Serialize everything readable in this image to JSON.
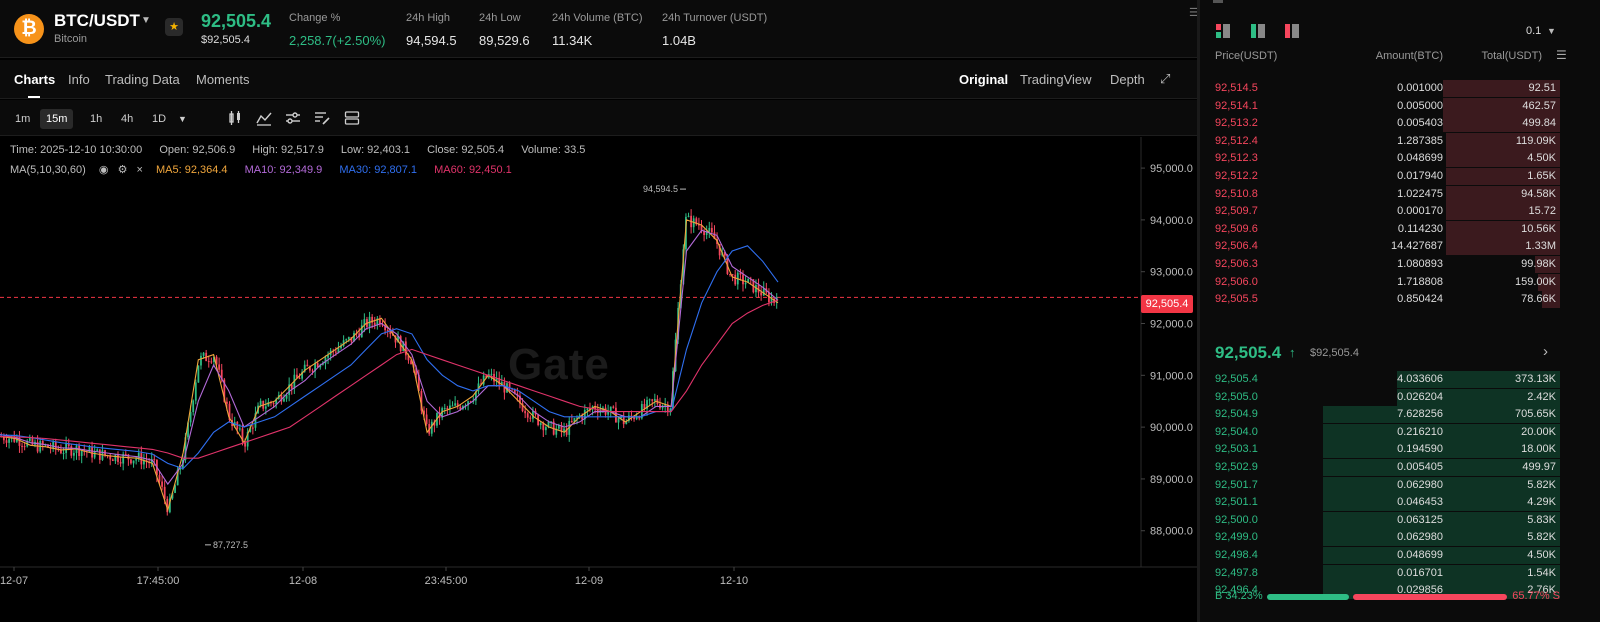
{
  "header": {
    "coin_symbol": "₿",
    "pair": "BTC/USDT",
    "coin_name": "Bitcoin",
    "last_price": "92,505.4",
    "last_price_sub": "$92,505.4",
    "stats": [
      {
        "label": "Change %",
        "value": "2,258.7(+2.50%)",
        "green": true
      },
      {
        "label": "24h High",
        "value": "94,594.5",
        "green": false
      },
      {
        "label": "24h Low",
        "value": "89,529.6",
        "green": false
      },
      {
        "label": "24h Volume (BTC)",
        "value": "11.34K",
        "green": false
      },
      {
        "label": "24h Turnover (USDT)",
        "value": "1.04B",
        "green": false
      }
    ]
  },
  "tabs": [
    "Charts",
    "Info",
    "Trading Data",
    "Moments"
  ],
  "views": [
    "Original",
    "TradingView",
    "Depth"
  ],
  "timeframes": [
    "1m",
    "15m",
    "1h",
    "4h",
    "1D"
  ],
  "tool_icons": [
    "candlestick-icon",
    "indicator-icon",
    "settings-sliders-icon",
    "draw-icon",
    "layout-icon"
  ],
  "chart_info": {
    "time": "Time: 2025-12-10 10:30:00",
    "open": "Open: 92,506.9",
    "high": "High: 92,517.9",
    "low": "Low: 92,403.1",
    "close": "Close: 92,505.4",
    "volume": "Volume: 33.5",
    "ma_label": "MA(5,10,30,60)",
    "ma5": "MA5: 92,364.4",
    "ma10": "MA10: 92,349.9",
    "ma30": "MA30: 92,807.1",
    "ma60": "MA60: 92,450.1"
  },
  "chart_data": {
    "type": "line",
    "title": "",
    "x_ticks": [
      "12-07",
      "17:45:00",
      "12-08",
      "23:45:00",
      "12-09",
      "12-10"
    ],
    "y_ticks": [
      "95,000.0",
      "94,000.0",
      "93,000.0",
      "92,000.0",
      "91,000.0",
      "90,000.0",
      "89,000.0",
      "88,000.0"
    ],
    "ylim": [
      87300,
      95600
    ],
    "current_price": 92505.4,
    "current_price_label": "92,505.4",
    "high_annotation": "94,594.5",
    "low_annotation": "87,727.5",
    "high_value": 94594.5,
    "low_value": 87727.5,
    "watermark": "Gate",
    "colors": {
      "up": "#2ebd85",
      "down": "#f6465d",
      "ma5": "#f0a63c",
      "ma10": "#b36ad8",
      "ma30": "#2f6ff0",
      "ma60": "#e0336a"
    },
    "series": [
      {
        "name": "MA5",
        "values": [
          89820,
          89780,
          89650,
          89620,
          89560,
          89580,
          89500,
          89450,
          89420,
          89400,
          89300,
          88400,
          89500,
          91300,
          91400,
          90200,
          89700,
          90400,
          90500,
          90800,
          91100,
          91300,
          91500,
          91700,
          92000,
          92100,
          91700,
          91300,
          89900,
          90300,
          90400,
          90600,
          91000,
          90800,
          90500,
          90200,
          90000,
          89900,
          90200,
          90400,
          90300,
          90100,
          90300,
          90500,
          90400,
          94000,
          93900,
          93600,
          92900,
          92800,
          92600,
          92400
        ]
      },
      {
        "name": "MA10",
        "values": [
          89860,
          89800,
          89700,
          89660,
          89600,
          89590,
          89540,
          89500,
          89460,
          89430,
          89360,
          88900,
          89300,
          90500,
          91200,
          90700,
          90000,
          90200,
          90400,
          90700,
          90900,
          91200,
          91400,
          91600,
          91900,
          92000,
          91800,
          91400,
          90500,
          90200,
          90300,
          90500,
          90800,
          90800,
          90600,
          90300,
          90100,
          90000,
          90100,
          90300,
          90300,
          90200,
          90200,
          90400,
          90400,
          93400,
          93800,
          93700,
          93100,
          92900,
          92700,
          92450
        ]
      },
      {
        "name": "MA30",
        "values": [
          89850,
          89840,
          89800,
          89750,
          89700,
          89660,
          89620,
          89590,
          89560,
          89530,
          89480,
          89300,
          89200,
          89500,
          89900,
          90100,
          90000,
          90100,
          90200,
          90400,
          90600,
          90800,
          91000,
          91200,
          91500,
          91800,
          91900,
          91800,
          91300,
          91000,
          90800,
          90700,
          90800,
          90800,
          90700,
          90500,
          90300,
          90200,
          90200,
          90200,
          90200,
          90200,
          90200,
          90300,
          90300,
          91500,
          92400,
          93000,
          93400,
          93500,
          93200,
          92800
        ]
      },
      {
        "name": "MA60",
        "values": [
          89820,
          89810,
          89800,
          89780,
          89750,
          89720,
          89690,
          89660,
          89630,
          89600,
          89570,
          89500,
          89400,
          89400,
          89500,
          89600,
          89700,
          89800,
          89900,
          90000,
          90200,
          90400,
          90600,
          90800,
          91000,
          91200,
          91400,
          91500,
          91400,
          91300,
          91200,
          91100,
          91000,
          90900,
          90800,
          90700,
          90600,
          90500,
          90400,
          90350,
          90300,
          90300,
          90300,
          90300,
          90300,
          90700,
          91200,
          91600,
          92000,
          92200,
          92350,
          92450
        ]
      }
    ]
  },
  "orderbook": {
    "tick": "0.1",
    "col_price": "Price(USDT)",
    "col_amount": "Amount(BTC)",
    "col_total": "Total(USDT)",
    "asks": [
      {
        "price": "92,514.5",
        "amount": "0.001000",
        "total": "92.51",
        "depth": 0.38
      },
      {
        "price": "92,514.1",
        "amount": "0.005000",
        "total": "462.57",
        "depth": 0.38
      },
      {
        "price": "92,513.2",
        "amount": "0.005403",
        "total": "499.84",
        "depth": 0.38
      },
      {
        "price": "92,512.4",
        "amount": "1.287385",
        "total": "119.09K",
        "depth": 0.37
      },
      {
        "price": "92,512.3",
        "amount": "0.048699",
        "total": "4.50K",
        "depth": 0.37
      },
      {
        "price": "92,512.2",
        "amount": "0.017940",
        "total": "1.65K",
        "depth": 0.37
      },
      {
        "price": "92,510.8",
        "amount": "1.022475",
        "total": "94.58K",
        "depth": 0.37
      },
      {
        "price": "92,509.7",
        "amount": "0.000170",
        "total": "15.72",
        "depth": 0.37
      },
      {
        "price": "92,509.6",
        "amount": "0.114230",
        "total": "10.56K",
        "depth": 0.37
      },
      {
        "price": "92,506.4",
        "amount": "14.427687",
        "total": "1.33M",
        "depth": 0.37
      },
      {
        "price": "92,506.3",
        "amount": "1.080893",
        "total": "99.98K",
        "depth": 0.08
      },
      {
        "price": "92,506.0",
        "amount": "1.718808",
        "total": "159.00K",
        "depth": 0.07
      },
      {
        "price": "92,505.5",
        "amount": "0.850424",
        "total": "78.66K",
        "depth": 0.06
      }
    ],
    "mid_price": "92,505.4",
    "mid_price_sub": "$92,505.4",
    "bids": [
      {
        "price": "92,505.4",
        "amount": "4.033606",
        "total": "373.13K",
        "depth": 0.53
      },
      {
        "price": "92,505.0",
        "amount": "0.026204",
        "total": "2.42K",
        "depth": 0.53
      },
      {
        "price": "92,504.9",
        "amount": "7.628256",
        "total": "705.65K",
        "depth": 0.77
      },
      {
        "price": "92,504.0",
        "amount": "0.216210",
        "total": "20.00K",
        "depth": 0.77
      },
      {
        "price": "92,503.1",
        "amount": "0.194590",
        "total": "18.00K",
        "depth": 0.77
      },
      {
        "price": "92,502.9",
        "amount": "0.005405",
        "total": "499.97",
        "depth": 0.77
      },
      {
        "price": "92,501.7",
        "amount": "0.062980",
        "total": "5.82K",
        "depth": 0.77
      },
      {
        "price": "92,501.1",
        "amount": "0.046453",
        "total": "4.29K",
        "depth": 0.77
      },
      {
        "price": "92,500.0",
        "amount": "0.063125",
        "total": "5.83K",
        "depth": 0.77
      },
      {
        "price": "92,499.0",
        "amount": "0.062980",
        "total": "5.82K",
        "depth": 0.77
      },
      {
        "price": "92,498.4",
        "amount": "0.048699",
        "total": "4.50K",
        "depth": 0.77
      },
      {
        "price": "92,497.8",
        "amount": "0.016701",
        "total": "1.54K",
        "depth": 0.77
      },
      {
        "price": "92,496.4",
        "amount": "0.029856",
        "total": "2.76K",
        "depth": 0.77
      }
    ],
    "buy_ratio": "B 34.23%",
    "sell_ratio": "65.77% S",
    "buy_ratio_value": 0.3423
  }
}
